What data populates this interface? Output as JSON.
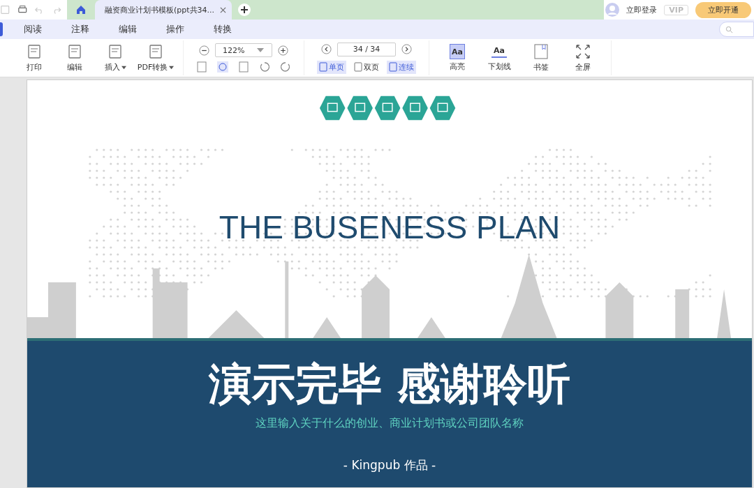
{
  "tabbar": {
    "tabs": [
      {
        "title": "融资商业计划书模板(ppt共34...",
        "selected": true
      }
    ],
    "login": "立即登录",
    "vip": "VIP",
    "upgrade": "立即开通"
  },
  "menu": [
    {
      "label": "阅读"
    },
    {
      "label": "注释"
    },
    {
      "label": "编辑"
    },
    {
      "label": "操作"
    },
    {
      "label": "转换"
    }
  ],
  "toolbar": {
    "tools": [
      {
        "label": "打印",
        "dropdown": false
      },
      {
        "label": "编辑",
        "dropdown": false
      },
      {
        "label": "插入",
        "dropdown": true
      },
      {
        "label": "PDF转换",
        "dropdown": true
      }
    ],
    "zoom": "122%",
    "page": "34 / 34",
    "view_modes": [
      {
        "label": "单页",
        "selected": true
      },
      {
        "label": "双页",
        "selected": false
      },
      {
        "label": "连续",
        "selected": true
      }
    ],
    "markup_tools": [
      {
        "label": "高亮",
        "kind": "highlight",
        "glyph": "Aa"
      },
      {
        "label": "下划线",
        "kind": "underline",
        "glyph": "Aa"
      },
      {
        "label": "书签",
        "kind": "bookmark"
      },
      {
        "label": "全屏",
        "kind": "fullscreen"
      }
    ]
  },
  "slide": {
    "title": "THE BUSENESS PLAN",
    "heading": "演示完毕 感谢聆听",
    "subtitle": "这里输入关于什么的创业、商业计划书或公司团队名称",
    "credit": "- Kingpub 作品 -"
  }
}
